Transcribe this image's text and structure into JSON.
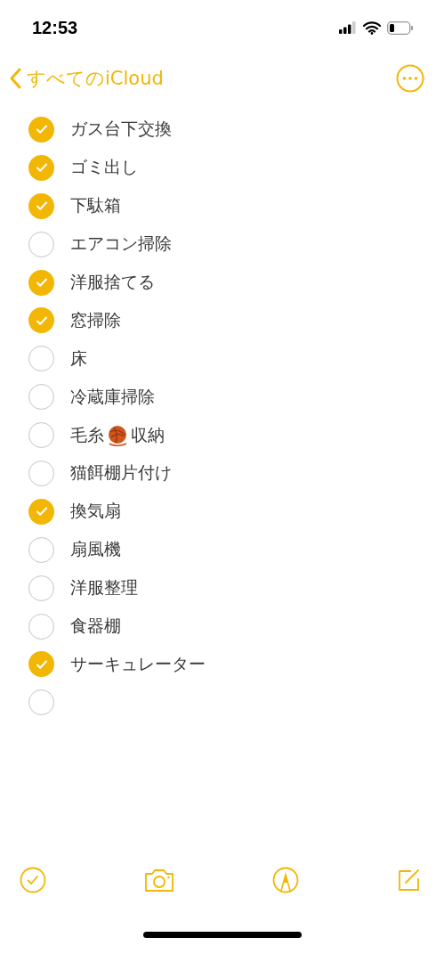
{
  "status_bar": {
    "time": "12:53"
  },
  "nav": {
    "back_label": "すべてのiCloud"
  },
  "checklist": [
    {
      "label": "ガス台下交換",
      "checked": true
    },
    {
      "label": "ゴミ出し",
      "checked": true
    },
    {
      "label": "下駄箱",
      "checked": true
    },
    {
      "label": "エアコン掃除",
      "checked": false
    },
    {
      "label": "洋服捨てる",
      "checked": true
    },
    {
      "label": "窓掃除",
      "checked": true
    },
    {
      "label": "床",
      "checked": false
    },
    {
      "label": "冷蔵庫掃除",
      "checked": false
    },
    {
      "label": "毛糸",
      "label_after": "収納",
      "checked": false
    },
    {
      "label": "猫餌棚片付け",
      "checked": false
    },
    {
      "label": "換気扇",
      "checked": true
    },
    {
      "label": "扇風機",
      "checked": false
    },
    {
      "label": "洋服整理",
      "checked": false
    },
    {
      "label": "食器棚",
      "checked": false
    },
    {
      "label": "サーキュレーター",
      "checked": true
    },
    {
      "checked": false
    }
  ]
}
